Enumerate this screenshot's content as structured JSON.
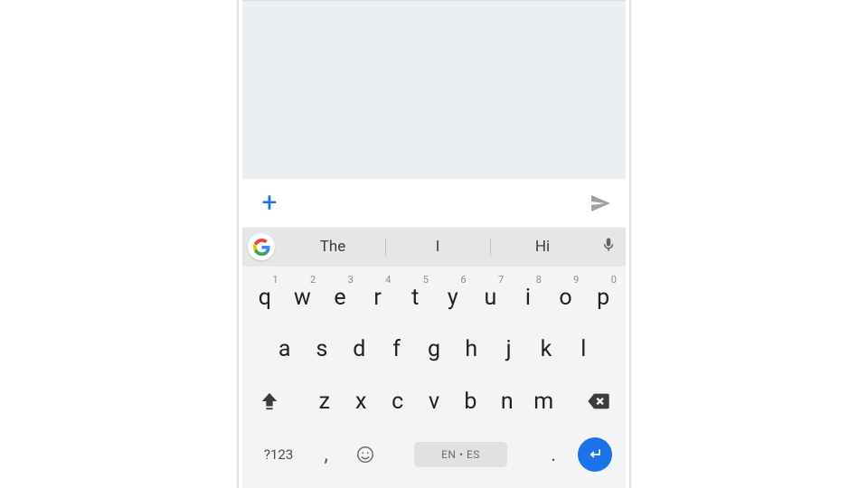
{
  "compose": {
    "plus_label": "+",
    "placeholder": ""
  },
  "suggestions": [
    "The",
    "I",
    "Hi"
  ],
  "keyboard": {
    "row1": [
      {
        "ch": "q",
        "hint": "1"
      },
      {
        "ch": "w",
        "hint": "2"
      },
      {
        "ch": "e",
        "hint": "3"
      },
      {
        "ch": "r",
        "hint": "4"
      },
      {
        "ch": "t",
        "hint": "5"
      },
      {
        "ch": "y",
        "hint": "6"
      },
      {
        "ch": "u",
        "hint": "7"
      },
      {
        "ch": "i",
        "hint": "8"
      },
      {
        "ch": "o",
        "hint": "9"
      },
      {
        "ch": "p",
        "hint": "0"
      }
    ],
    "row2": [
      "a",
      "s",
      "d",
      "f",
      "g",
      "h",
      "j",
      "k",
      "l"
    ],
    "row3": [
      "z",
      "x",
      "c",
      "v",
      "b",
      "n",
      "m"
    ],
    "symbols_label": "?123",
    "comma": ",",
    "period": ".",
    "space_label": "EN • ES"
  }
}
